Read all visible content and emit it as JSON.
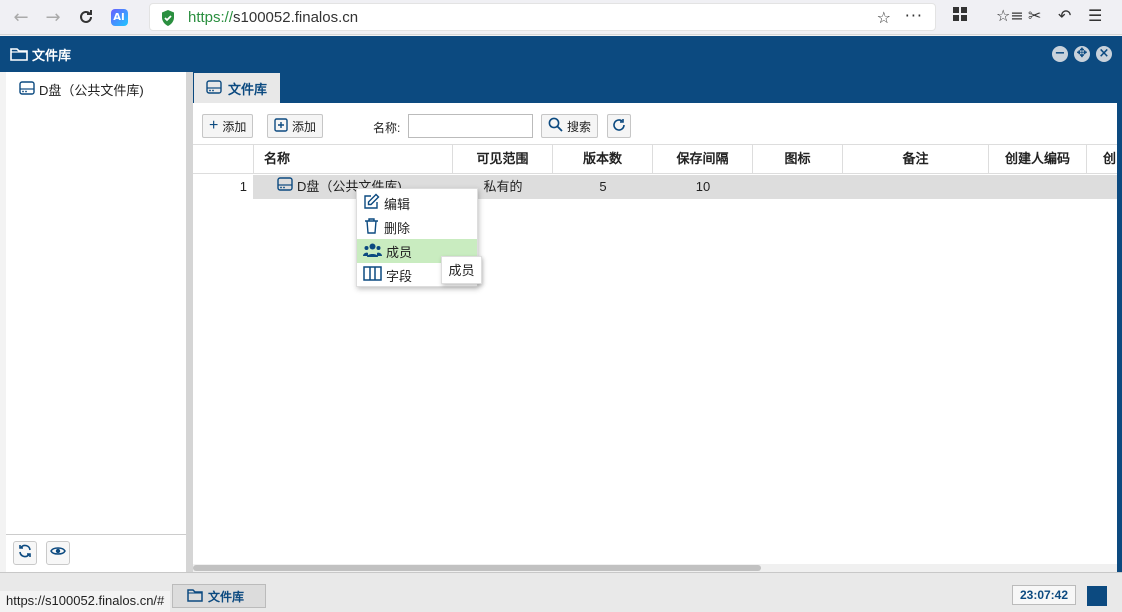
{
  "browser": {
    "url_protocol": "https://",
    "url_host": "s100052.finalos.cn",
    "ai_badge": "AI"
  },
  "app": {
    "title": "文件库"
  },
  "sidebar": {
    "tree_items": [
      {
        "label": "D盘（公共文件库)"
      }
    ]
  },
  "tabs": [
    {
      "label": "文件库"
    }
  ],
  "toolbar": {
    "add1_label": "添加",
    "add2_label": "添加",
    "name_label": "名称:",
    "name_value": "",
    "search_label": "搜索"
  },
  "grid": {
    "columns": [
      "名称",
      "可见范围",
      "版本数",
      "保存间隔",
      "图标",
      "备注",
      "创建人编码",
      "创"
    ],
    "rows": [
      {
        "num": "1",
        "name": "D盘（公共文件库)",
        "visibility": "私有的",
        "versions": "5",
        "interval": "10",
        "icon": "",
        "note": "",
        "creator": ""
      }
    ]
  },
  "context_menu": {
    "items": [
      {
        "label": "编辑",
        "icon": "edit-icon"
      },
      {
        "label": "删除",
        "icon": "trash-icon"
      },
      {
        "label": "成员",
        "icon": "members-icon"
      },
      {
        "label": "字段",
        "icon": "columns-icon"
      }
    ]
  },
  "tooltip": {
    "text": "成员"
  },
  "taskbar": {
    "window_label": "文件库",
    "clock": "23:07:42",
    "status_url": "https://s100052.finalos.cn/#"
  },
  "colors": {
    "primary": "#0c4a80",
    "menu_hover": "#c9ecc0",
    "secure_green": "#2a8f3f"
  }
}
